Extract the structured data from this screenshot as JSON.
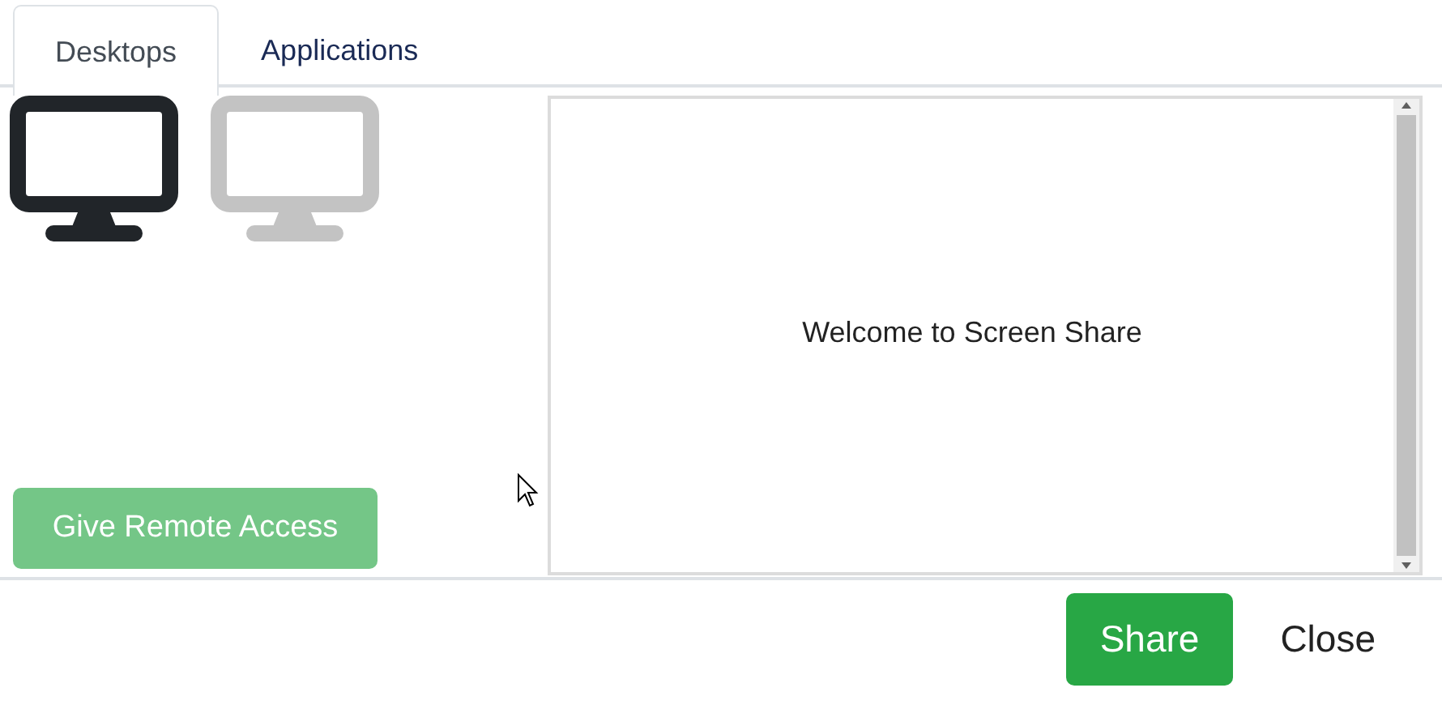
{
  "tabs": [
    {
      "label": "Desktops",
      "selected": true
    },
    {
      "label": "Applications",
      "selected": false
    }
  ],
  "desktops": [
    {
      "selected": true
    },
    {
      "selected": false
    }
  ],
  "remote_access_button": {
    "label": "Give Remote Access",
    "disabled": true
  },
  "preview": {
    "message": "Welcome to Screen Share"
  },
  "buttons": [
    {
      "label": "Share",
      "kind": "primary"
    },
    {
      "label": "Close",
      "kind": "plain"
    }
  ]
}
